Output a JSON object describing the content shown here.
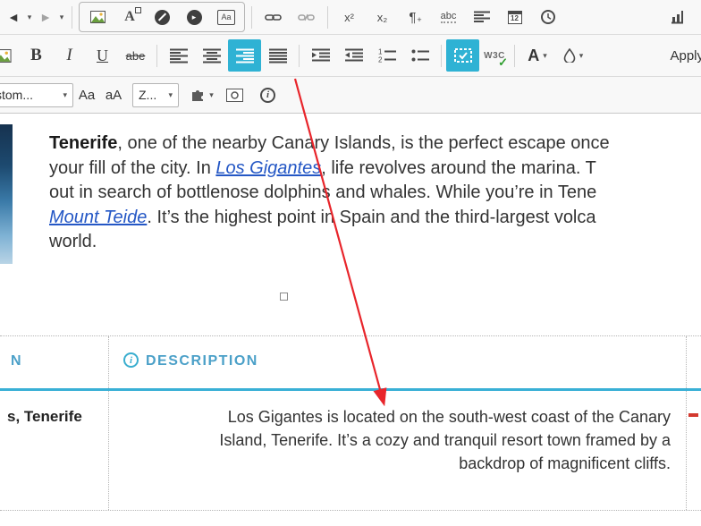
{
  "colors": {
    "toolbar_background": "#f8f8f8",
    "active_button_teal": "#2fb2d4",
    "link_blue": "#2457c5",
    "table_header_blue": "#4ba0c8",
    "table_header_underline": "#39b0d6",
    "annotation_arrow_red": "#e8252b"
  },
  "toolbar_row1": {
    "undo_icon": "◄",
    "redo_icon": "►",
    "dropdown_caret": "▾",
    "anchor_letter": "A",
    "media_play_glyph": "▸",
    "textfield_label": "Aa",
    "superscript_label": "x²",
    "subscript_label": "x₂",
    "pilcrow_label": "¶",
    "pilcrow_plus": "+",
    "spellcheck_label": "abc",
    "calendar_day": "12"
  },
  "toolbar_row2": {
    "bold_label": "B",
    "italic_label": "I",
    "underline_label": "U",
    "strike_label": "abe",
    "list_number_1": "1",
    "list_number_2": "2",
    "w3c_label": "W3C",
    "w3c_check": "✓",
    "font_color_letter": "A",
    "dropdown_caret": "▾",
    "apply_label": "Apply"
  },
  "toolbar_row3": {
    "styles_dropdown_value": "stom...",
    "case_upper_first": "Aa",
    "case_lower_first": "aA",
    "zoom_dropdown_value": "Z...",
    "dropdown_caret": "▾",
    "info_letter": "i"
  },
  "paragraph": {
    "line1_bold": "Tenerife",
    "line1_rest": ", one of the nearby Canary Islands, is the perfect escape once",
    "line2_pre": "your fill of the city. In ",
    "line2_link": "Los Gigantes",
    "line2_post": ", life revolves around the marina. T",
    "line3": "out in search of bottlenose dolphins and whales. While you’re in Tene",
    "line4_link": "Mount Teide",
    "line4_post": ". It’s the highest point in Spain and the third-largest volca",
    "line5": "world."
  },
  "table": {
    "col1_header": "N",
    "col2_header": "DESCRIPTION",
    "col2_header_info": "i",
    "col1_cell": "s, Tenerife",
    "desc_line1": "Los Gigantes is located on the south-west coast of the Canary",
    "desc_line2": "Island, Tenerife. It’s a cozy and tranquil resort town framed by a",
    "desc_line3": "backdrop of magnificent cliffs."
  }
}
